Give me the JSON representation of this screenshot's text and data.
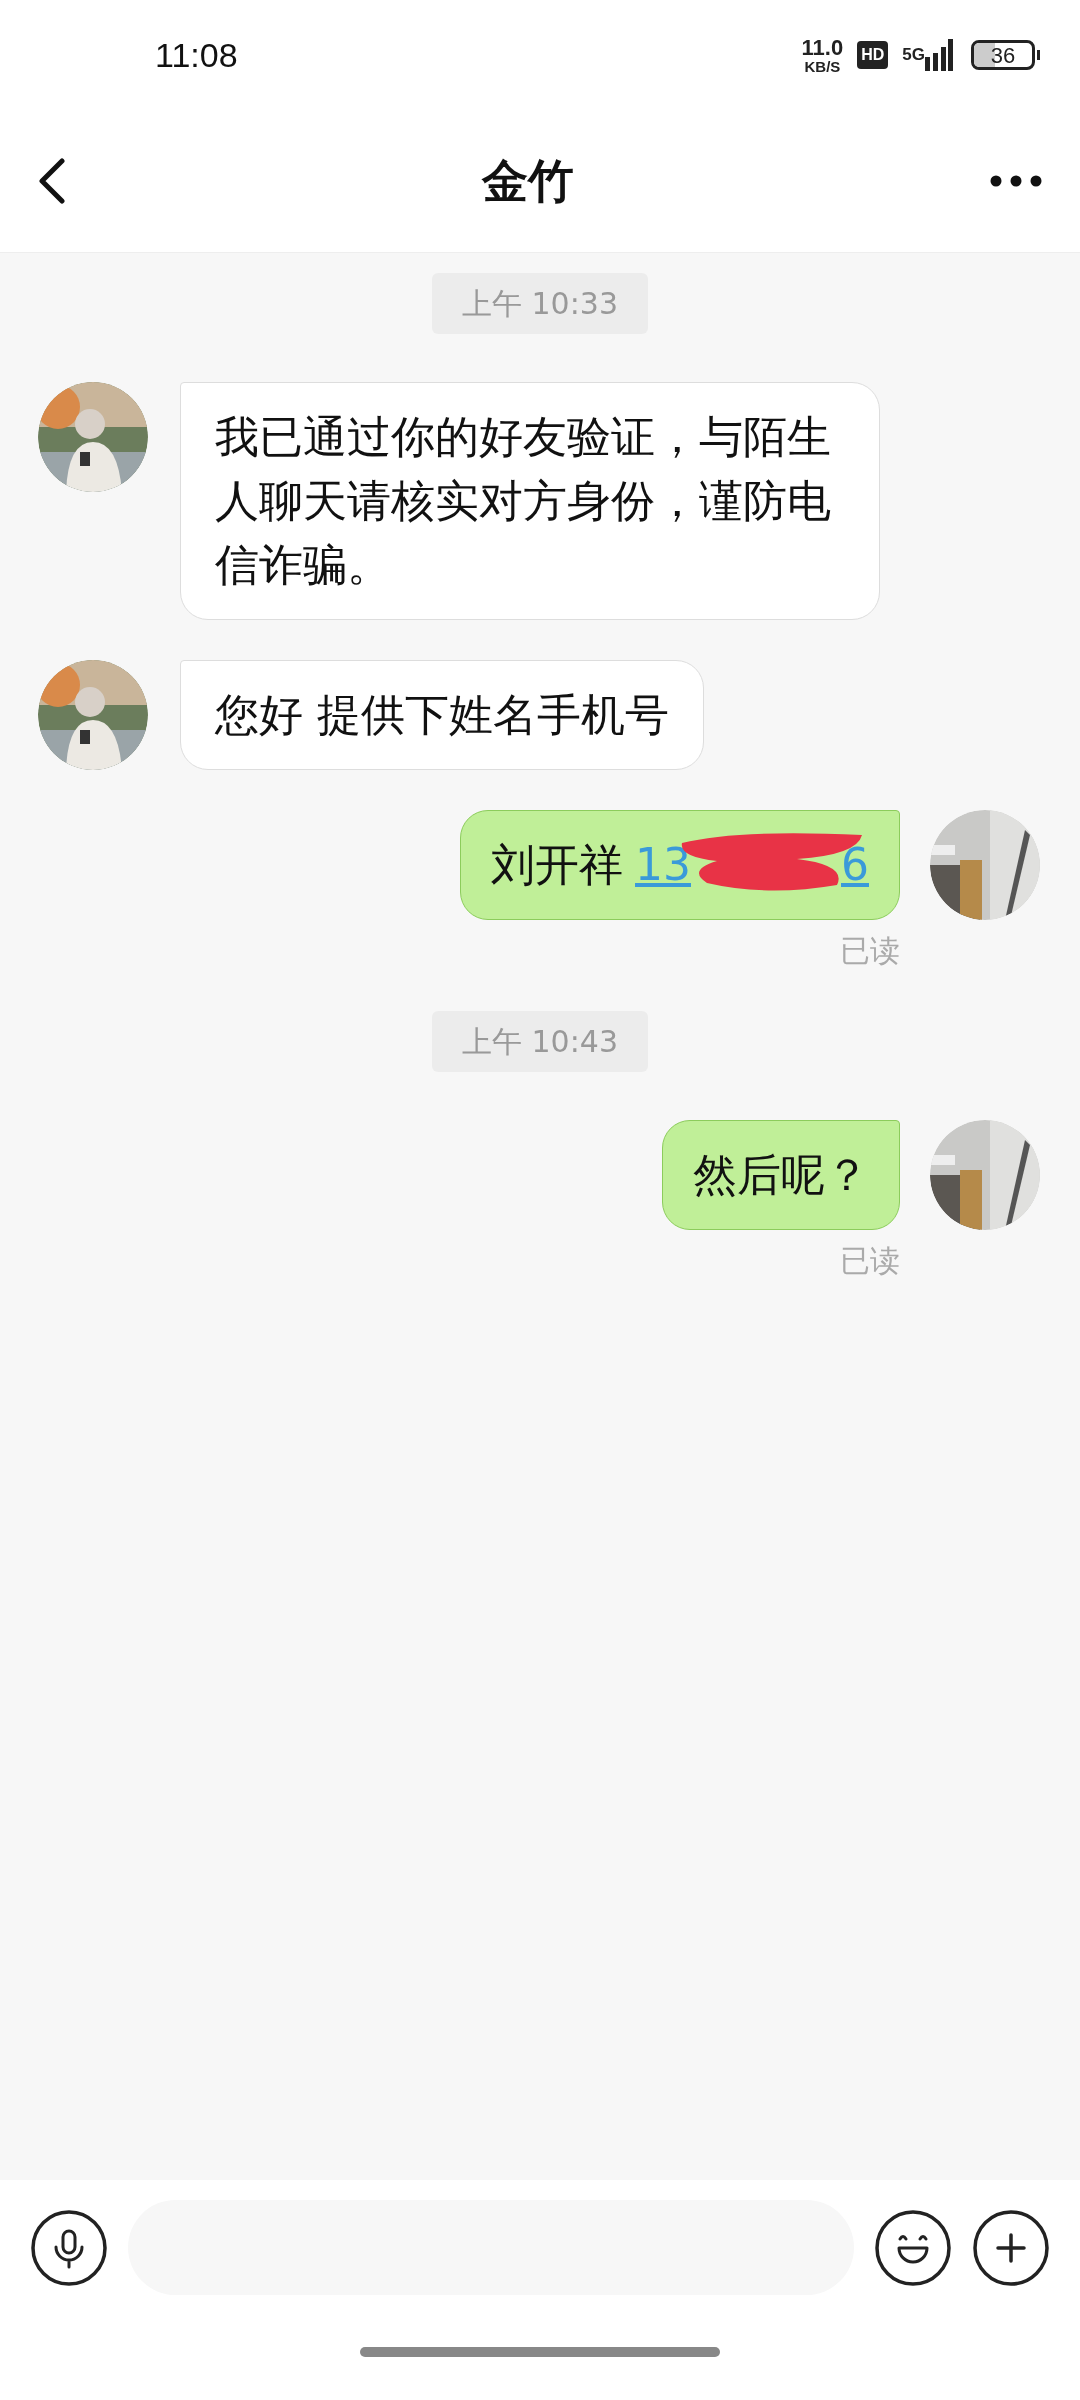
{
  "status_bar": {
    "time": "11:08",
    "net_speed": "11.0",
    "net_unit": "KB/S",
    "hd": "HD",
    "network": "5G",
    "battery": "36"
  },
  "header": {
    "title": "金竹"
  },
  "messages": [
    {
      "kind": "time",
      "text": "上午 10:33"
    },
    {
      "kind": "incoming",
      "text": "我已通过你的好友验证，与陌生人聊天请核实对方身份，谨防电信诈骗。"
    },
    {
      "kind": "incoming",
      "text": "您好 提供下姓名手机号"
    },
    {
      "kind": "outgoing",
      "text": "刘开祥",
      "link_start": "13",
      "link_end": "6",
      "redacted": true,
      "receipt": "已读"
    },
    {
      "kind": "time",
      "text": "上午 10:43"
    },
    {
      "kind": "outgoing",
      "text": "然后呢？",
      "receipt": "已读"
    }
  ]
}
